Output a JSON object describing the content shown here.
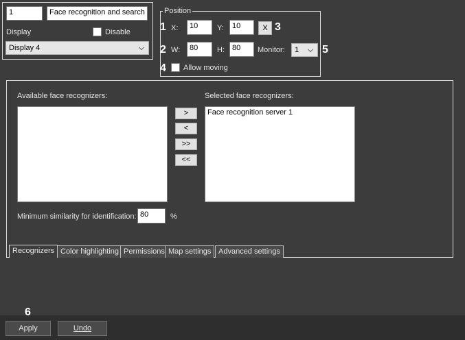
{
  "top_left": {
    "id_value": "1",
    "name_value": "Face recognition and search \"",
    "display_label": "Display",
    "disable_label": "Disable",
    "display_select": "Display 4"
  },
  "position": {
    "title": "Position",
    "x_label": "X:",
    "x_value": "10",
    "y_label": "Y:",
    "y_value": "10",
    "close_glyph": "X",
    "w_label": "W:",
    "w_value": "80",
    "h_label": "H:",
    "h_value": "80",
    "monitor_label": "Monitor:",
    "monitor_value": "1",
    "allow_moving_label": "Allow moving"
  },
  "callouts": {
    "c1": "1",
    "c2": "2",
    "c3": "3",
    "c4": "4",
    "c5": "5",
    "c6": "6"
  },
  "recognizers": {
    "available_label": "Available face recognizers:",
    "selected_label": "Selected face recognizers:",
    "available_items": [],
    "selected_items": [
      "Face recognition server 1"
    ],
    "move_buttons": [
      ">",
      "<",
      ">>",
      "<<"
    ],
    "min_similarity_label": "Minimum similarity for identification:",
    "min_similarity_value": "80",
    "percent": "%"
  },
  "tabs": [
    "Recognizers",
    "Color highlighting",
    "Permissions",
    "Map settings",
    "Advanced settings"
  ],
  "footer": {
    "apply": "Apply",
    "undo": "Undo"
  }
}
